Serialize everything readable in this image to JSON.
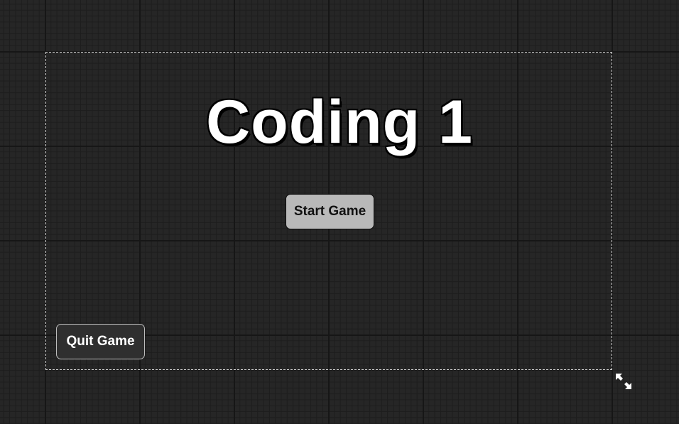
{
  "title": "Coding 1",
  "buttons": {
    "start_label": "Start Game",
    "quit_label": "Quit Game"
  },
  "icons": {
    "resize": "resize-diagonal-arrows-icon"
  },
  "colors": {
    "background": "#262626",
    "title_text": "#ffffff",
    "title_outline": "#000000",
    "start_button_bg": "#b9b9b9",
    "quit_button_bg": "#2f2f2f",
    "canvas_border": "#d6d6d6"
  }
}
